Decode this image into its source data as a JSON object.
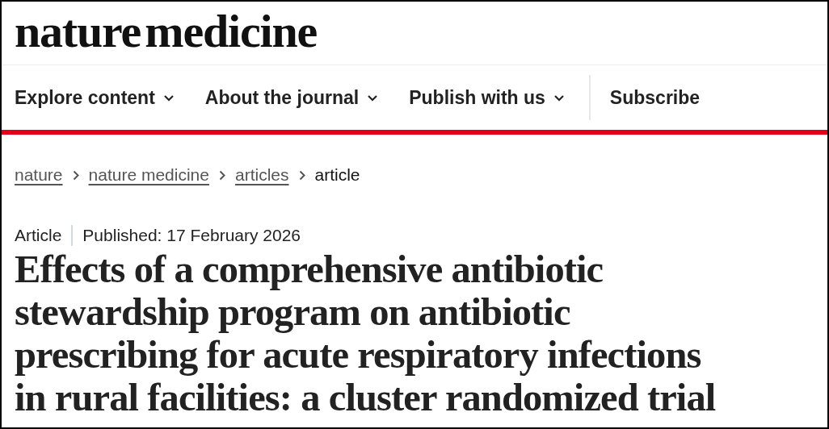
{
  "logo": "nature medicine",
  "nav": [
    {
      "label": "Explore content",
      "kind": "menu"
    },
    {
      "label": "About the journal",
      "kind": "menu"
    },
    {
      "label": "Publish with us",
      "kind": "menu"
    },
    {
      "label": "Subscribe",
      "kind": "link"
    }
  ],
  "breadcrumbs": [
    {
      "label": "nature",
      "current": false
    },
    {
      "label": "nature medicine",
      "current": false
    },
    {
      "label": "articles",
      "current": false
    },
    {
      "label": "article",
      "current": true
    }
  ],
  "article": {
    "type": "Article",
    "published": "Published: 17 February 2026",
    "title": "Effects of a comprehensive antibiotic stewardship program on antibiotic prescribing for acute respiratory infections in rural facilities: a cluster randomized trial"
  }
}
